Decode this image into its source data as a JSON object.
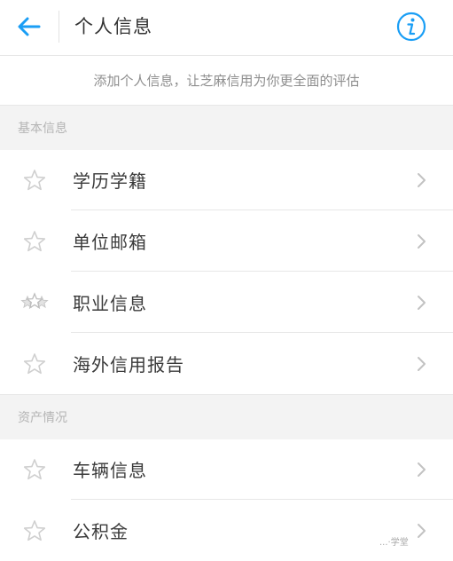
{
  "header": {
    "title": "个人信息",
    "back_icon": "arrow-left-icon",
    "info_icon": "info-circle-icon",
    "accent_color": "#1a9ef5"
  },
  "hint_text": "添加个人信息，让芝麻信用为你更全面的评估",
  "sections": [
    {
      "title": "基本信息",
      "items": [
        {
          "label": "学历学籍",
          "icon": "star-outline-icon"
        },
        {
          "label": "单位邮箱",
          "icon": "star-outline-icon"
        },
        {
          "label": "职业信息",
          "icon": "star-multi-icon"
        },
        {
          "label": "海外信用报告",
          "icon": "star-outline-icon"
        }
      ]
    },
    {
      "title": "资产情况",
      "items": [
        {
          "label": "车辆信息",
          "icon": "star-outline-icon"
        },
        {
          "label": "公积金",
          "icon": "star-outline-icon"
        }
      ]
    }
  ],
  "watermark": "...·学堂"
}
